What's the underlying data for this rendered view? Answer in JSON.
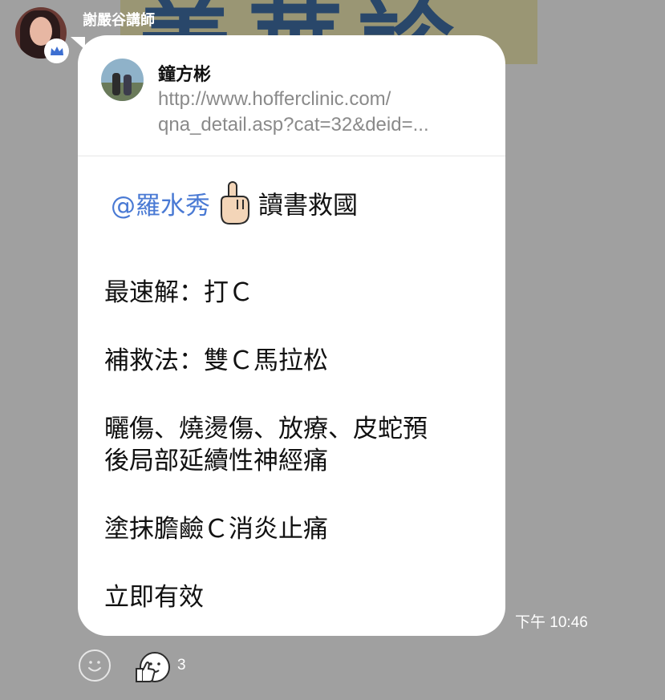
{
  "background": {
    "banner_text": "善華診所"
  },
  "sender": {
    "name": "謝嚴谷講師",
    "avatar": "avatar",
    "badge": "crown-icon"
  },
  "reply_preview": {
    "name": "鐘方彬",
    "url_line1": "http://www.hofferclinic.com/",
    "url_line2": "qna_detail.asp?cat=32&deid=..."
  },
  "message": {
    "mention": "@羅水秀",
    "hand_icon": "pointing-up-hand-emoji",
    "line1_text": "讀書救國",
    "line2": "最速解：打Ｃ",
    "line3": "補救法：雙Ｃ馬拉松",
    "line4a": "曬傷、燒燙傷、放療、皮蛇預",
    "line4b": "後局部延續性神經痛",
    "line5": "塗抹膽鹼Ｃ消炎止痛",
    "line6": "立即有效"
  },
  "timestamp": "下午 10:46",
  "reactions": {
    "add_icon": "smiley-icon",
    "sticker_icon": "thumbs-up-face-icon",
    "count": "3"
  },
  "colors": {
    "mention": "#4a7ad4",
    "bubble": "#ffffff",
    "background": "#a0a0a0"
  }
}
